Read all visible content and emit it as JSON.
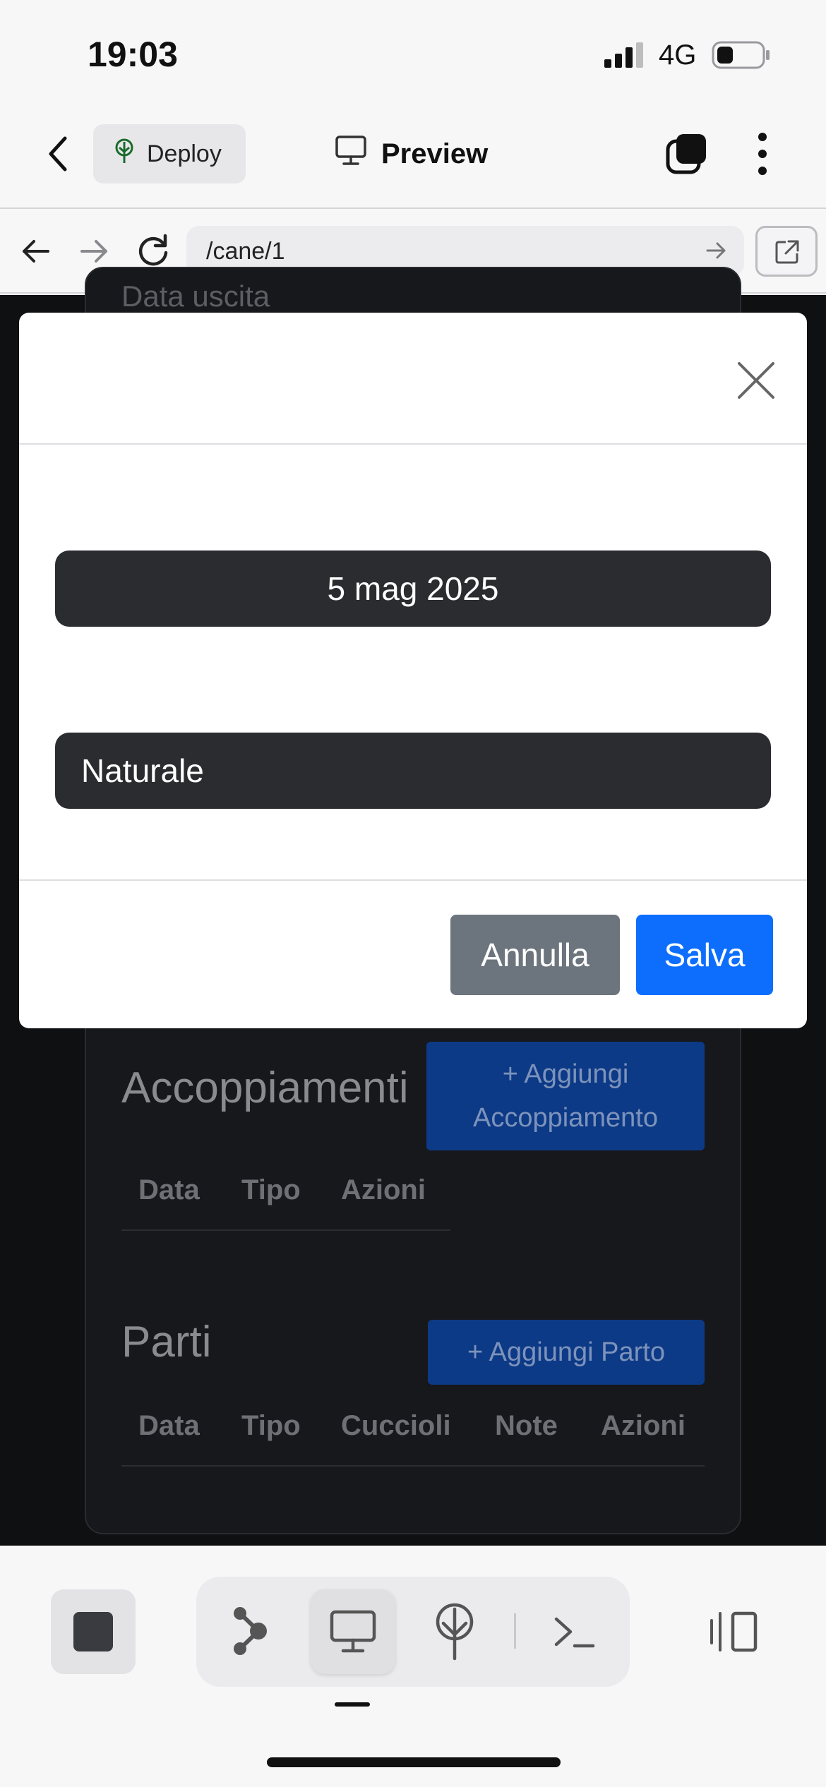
{
  "status_bar": {
    "time": "19:03",
    "network": "4G"
  },
  "app_bar": {
    "deploy_label": "Deploy",
    "preview_label": "Preview"
  },
  "browser": {
    "url": "/cane/1"
  },
  "background_page": {
    "partial_label": "Data uscita",
    "accoppiamenti": {
      "title": "Accoppiamenti",
      "add_button": "+ Aggiungi Accoppiamento",
      "columns": [
        "Data",
        "Tipo",
        "Azioni"
      ]
    },
    "parti": {
      "title": "Parti",
      "add_button": "+ Aggiungi Parto",
      "columns": [
        "Data",
        "Tipo",
        "Cuccioli",
        "Note",
        "Azioni"
      ]
    }
  },
  "modal": {
    "date_value": "5 mag 2025",
    "type_value": "Naturale",
    "cancel_label": "Annulla",
    "save_label": "Salva"
  },
  "colors": {
    "primary": "#0d6efd",
    "secondary": "#6c757d",
    "field_bg": "#2b2c30"
  },
  "icons": [
    "back-chevron-icon",
    "deploy-tree-icon",
    "monitor-icon",
    "tabs-icon",
    "more-vertical-icon",
    "arrow-left-icon",
    "arrow-right-icon",
    "reload-icon",
    "open-external-icon",
    "close-icon",
    "stop-icon",
    "share-node-icon",
    "deploy-icon",
    "terminal-icon",
    "side-panel-icon"
  ]
}
